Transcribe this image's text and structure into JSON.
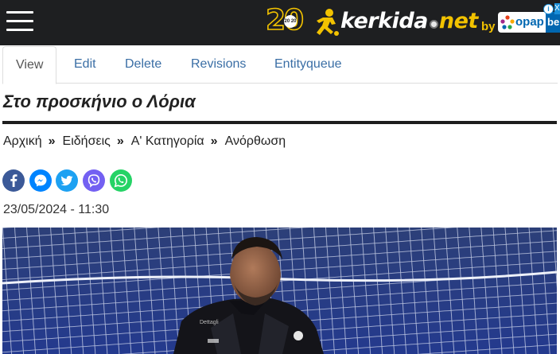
{
  "header": {
    "menu_icon": "hamburger-menu-icon",
    "anniversary_number": "20",
    "anniversary_badge": "20 20",
    "brand_main": "kerkida",
    "brand_tld": "net",
    "by_label": "by",
    "sponsor": "opap",
    "sponsor_suffix": "be",
    "ad_info_icon": "info-icon",
    "ad_close_label": "X"
  },
  "tabs": [
    {
      "label": "View",
      "active": true
    },
    {
      "label": "Edit",
      "active": false
    },
    {
      "label": "Delete",
      "active": false
    },
    {
      "label": "Revisions",
      "active": false
    },
    {
      "label": "Entityqueue",
      "active": false
    }
  ],
  "article": {
    "title": "Στο προσκήνιο ο Λόρια",
    "breadcrumb": [
      "Αρχική",
      "Ειδήσεις",
      "Α' Κατηγορία",
      "Ανόρθωση"
    ],
    "breadcrumb_separator": "»",
    "date": "23/05/2024 - 11:30",
    "share": [
      {
        "name": "facebook",
        "color": "#3b5998"
      },
      {
        "name": "messenger",
        "color": "#0084ff"
      },
      {
        "name": "twitter",
        "color": "#1da1f2"
      },
      {
        "name": "viber",
        "color": "#7360f2"
      },
      {
        "name": "whatsapp",
        "color": "#25d366"
      }
    ]
  },
  "colors": {
    "header_bg": "#1e1f21",
    "accent_yellow": "#f2c200",
    "link_blue": "#3a6ea5"
  }
}
